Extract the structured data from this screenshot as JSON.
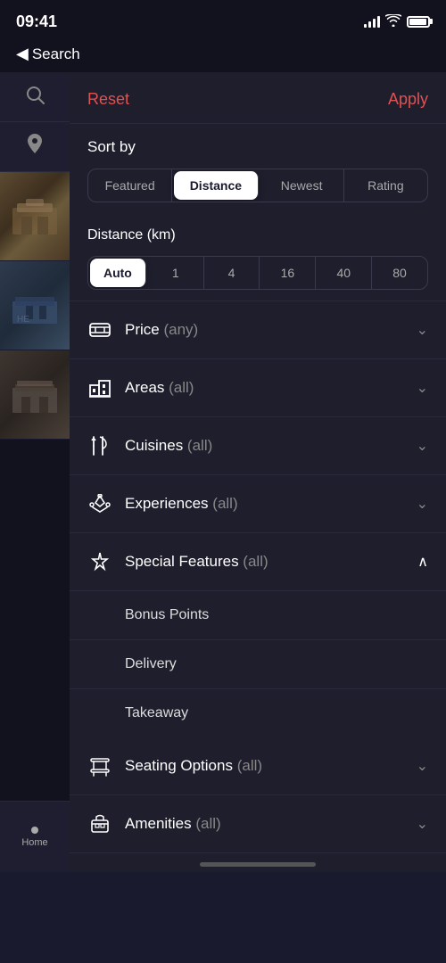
{
  "statusBar": {
    "time": "09:41",
    "backLabel": "Search"
  },
  "header": {
    "resetLabel": "Reset",
    "applyLabel": "Apply"
  },
  "sortBy": {
    "label": "Sort by",
    "tabs": [
      {
        "id": "featured",
        "label": "Featured",
        "active": false
      },
      {
        "id": "distance",
        "label": "Distance",
        "active": true
      },
      {
        "id": "newest",
        "label": "Newest",
        "active": false
      },
      {
        "id": "rating",
        "label": "Rating",
        "active": false
      }
    ]
  },
  "distance": {
    "label": "Distance (km)",
    "tabs": [
      {
        "id": "auto",
        "label": "Auto",
        "active": true
      },
      {
        "id": "1",
        "label": "1",
        "active": false
      },
      {
        "id": "4",
        "label": "4",
        "active": false
      },
      {
        "id": "16",
        "label": "16",
        "active": false
      },
      {
        "id": "40",
        "label": "40",
        "active": false
      },
      {
        "id": "80",
        "label": "80",
        "active": false
      }
    ]
  },
  "filters": [
    {
      "id": "price",
      "label": "Price",
      "sub": "(any)",
      "icon": "price",
      "expanded": false
    },
    {
      "id": "areas",
      "label": "Areas",
      "sub": "(all)",
      "icon": "areas",
      "expanded": false
    },
    {
      "id": "cuisines",
      "label": "Cuisines",
      "sub": "(all)",
      "icon": "cuisines",
      "expanded": false
    },
    {
      "id": "experiences",
      "label": "Experiences",
      "sub": "(all)",
      "icon": "experiences",
      "expanded": false
    },
    {
      "id": "special-features",
      "label": "Special Features",
      "sub": "(all)",
      "icon": "features",
      "expanded": true,
      "subItems": [
        "Bonus Points",
        "Delivery",
        "Takeaway"
      ]
    },
    {
      "id": "seating-options",
      "label": "Seating Options",
      "sub": "(all)",
      "icon": "seating",
      "expanded": false
    },
    {
      "id": "amenities",
      "label": "Amenities",
      "sub": "(all)",
      "icon": "amenities",
      "expanded": false
    }
  ],
  "bottomNav": {
    "homeLabel": "Home"
  }
}
